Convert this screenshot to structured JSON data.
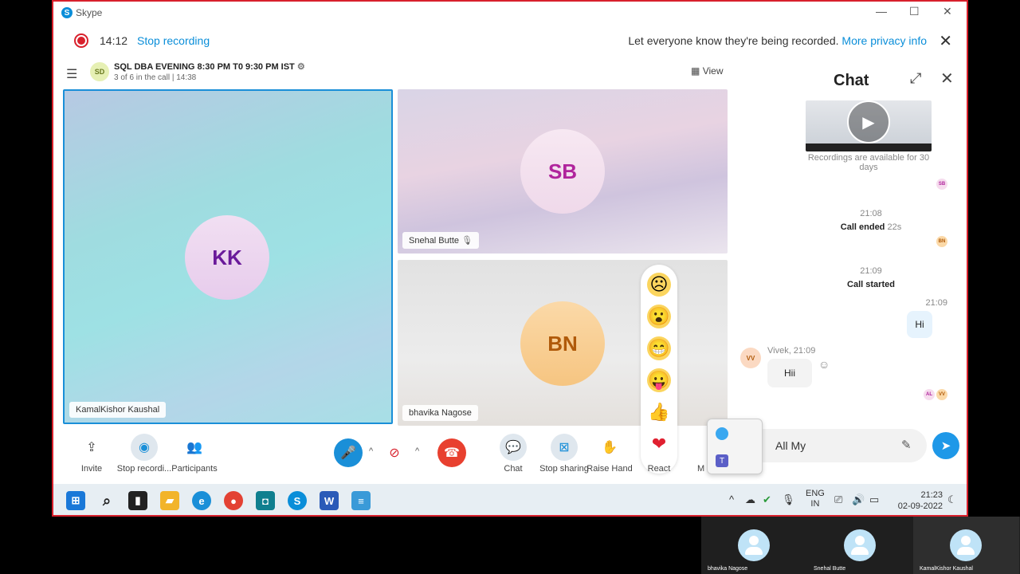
{
  "window": {
    "title": "Skype",
    "minimize": "—",
    "maximize": "☐",
    "close": "✕"
  },
  "recording": {
    "time": "14:12",
    "stop_label": "Stop recording",
    "notice": "Let everyone know they're being recorded.",
    "privacy_link": "More privacy info",
    "close": "✕"
  },
  "call": {
    "avatar": "SD",
    "title": "SQL DBA EVENING 8:30 PM T0 9:30 PM IST",
    "subtitle": "3 of 6 in the call | 14:38",
    "view_label": "View"
  },
  "participants": [
    {
      "initials": "KK",
      "name": "KamalKishor Kaushal"
    },
    {
      "initials": "SB",
      "name": "Snehal Butte"
    },
    {
      "initials": "BN",
      "name": "bhavika Nagose"
    }
  ],
  "reactions": [
    "☹",
    "😮",
    "😁",
    "😛",
    "👍",
    "❤"
  ],
  "toolbar": {
    "invite": "Invite",
    "stop_recording": "Stop recordi...",
    "participants": "Participants",
    "chat": "Chat",
    "stop_sharing": "Stop sharing",
    "raise_hand": "Raise Hand",
    "react": "React",
    "more": "M"
  },
  "chat": {
    "title": "Chat",
    "recording_note": "Recordings are available for 30 days",
    "ended_time": "21:08",
    "ended_label": "Call ended",
    "ended_duration": "22s",
    "started_time": "21:09",
    "started_label": "Call started",
    "my_time": "21:09",
    "my_msg": "Hi",
    "vivek_meta": "Vivek, 21:09",
    "vivek_avatar": "VV",
    "vivek_msg": "Hii",
    "input_value": "All My",
    "mini_sb": "SB",
    "mini_bn": "BN",
    "mini_al": "AL",
    "mini_vv": "VV"
  },
  "taskbar": {
    "lang1": "ENG",
    "lang2": "IN",
    "time": "21:23",
    "date": "02-09-2022"
  },
  "strip": [
    "bhavika Nagose",
    "Snehal Butte",
    "KamalKishor Kaushal"
  ],
  "colors": {
    "accent": "#0a8ed9",
    "record": "#d8202c",
    "end_call": "#e8402f",
    "mic": "#1a8fd8"
  }
}
